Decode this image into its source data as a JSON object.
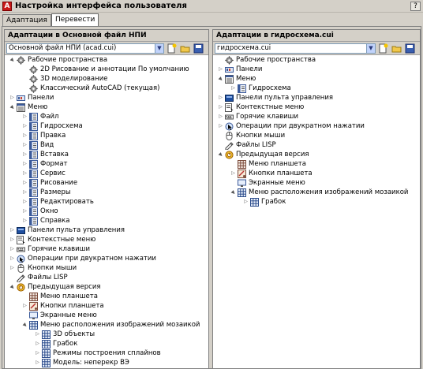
{
  "window": {
    "title": "Настройка интерфейса пользователя",
    "help_label": "?"
  },
  "tabs": [
    {
      "label": "Адаптация",
      "active": false
    },
    {
      "label": "Перевести",
      "active": true
    }
  ],
  "left_pane": {
    "header": "Адаптации в Основной файл НПИ",
    "file_value": "Основной файл НПИ (acad.cui)",
    "tree": [
      {
        "level": 0,
        "toggle": "open",
        "icon": "gear",
        "label": "Рабочие пространства"
      },
      {
        "level": 1,
        "toggle": "none",
        "icon": "gear",
        "label": "2D Рисование и аннотации По умолчанию"
      },
      {
        "level": 1,
        "toggle": "none",
        "icon": "gear",
        "label": "3D моделирование"
      },
      {
        "level": 1,
        "toggle": "none",
        "icon": "gear",
        "label": "Классический AutoCAD (текущая)"
      },
      {
        "level": 0,
        "toggle": "closed",
        "icon": "toolbar",
        "label": "Панели"
      },
      {
        "level": 0,
        "toggle": "open",
        "icon": "menu",
        "label": "Меню"
      },
      {
        "level": 1,
        "toggle": "closed",
        "icon": "menu-item",
        "label": "Файл"
      },
      {
        "level": 1,
        "toggle": "closed",
        "icon": "menu-item",
        "label": "Гидросхема"
      },
      {
        "level": 1,
        "toggle": "closed",
        "icon": "menu-item",
        "label": "Правка"
      },
      {
        "level": 1,
        "toggle": "closed",
        "icon": "menu-item",
        "label": "Вид"
      },
      {
        "level": 1,
        "toggle": "closed",
        "icon": "menu-item",
        "label": "Вставка"
      },
      {
        "level": 1,
        "toggle": "closed",
        "icon": "menu-item",
        "label": "Формат"
      },
      {
        "level": 1,
        "toggle": "closed",
        "icon": "menu-item",
        "label": "Сервис"
      },
      {
        "level": 1,
        "toggle": "closed",
        "icon": "menu-item",
        "label": "Рисование"
      },
      {
        "level": 1,
        "toggle": "closed",
        "icon": "menu-item",
        "label": "Размеры"
      },
      {
        "level": 1,
        "toggle": "closed",
        "icon": "menu-item",
        "label": "Редактировать"
      },
      {
        "level": 1,
        "toggle": "closed",
        "icon": "menu-item",
        "label": "Окно"
      },
      {
        "level": 1,
        "toggle": "closed",
        "icon": "menu-item",
        "label": "Справка"
      },
      {
        "level": 0,
        "toggle": "closed",
        "icon": "dashboard",
        "label": "Панели пульта управления"
      },
      {
        "level": 0,
        "toggle": "closed",
        "icon": "context",
        "label": "Контекстные меню"
      },
      {
        "level": 0,
        "toggle": "closed",
        "icon": "keys",
        "label": "Горячие клавиши"
      },
      {
        "level": 0,
        "toggle": "closed",
        "icon": "dblclick",
        "label": "Операции при двукратном нажатии"
      },
      {
        "level": 0,
        "toggle": "closed",
        "icon": "mouse",
        "label": "Кнопки мыши"
      },
      {
        "level": 0,
        "toggle": "none",
        "icon": "lisp",
        "label": "Файлы LISP"
      },
      {
        "level": 0,
        "toggle": "open",
        "icon": "legacy",
        "label": "Предыдущая версия"
      },
      {
        "level": 1,
        "toggle": "none",
        "icon": "tablet",
        "label": "Меню планшета"
      },
      {
        "level": 1,
        "toggle": "closed",
        "icon": "tablet-btn",
        "label": "Кнопки планшета"
      },
      {
        "level": 1,
        "toggle": "none",
        "icon": "screen",
        "label": "Экранные меню"
      },
      {
        "level": 1,
        "toggle": "open",
        "icon": "grid",
        "label": "Меню расположения изображений мозаикой"
      },
      {
        "level": 2,
        "toggle": "closed",
        "icon": "grid",
        "label": "3D объекты"
      },
      {
        "level": 2,
        "toggle": "closed",
        "icon": "grid",
        "label": "Грабок"
      },
      {
        "level": 2,
        "toggle": "closed",
        "icon": "grid",
        "label": "Режимы построения сплайнов"
      },
      {
        "level": 2,
        "toggle": "closed",
        "icon": "grid",
        "label": "Модель: неперекр ВЭ"
      }
    ]
  },
  "right_pane": {
    "header": "Адаптации в гидросхема.cui",
    "file_value": "гидросхема.cui",
    "tree": [
      {
        "level": 0,
        "toggle": "none",
        "icon": "gear",
        "label": "Рабочие пространства"
      },
      {
        "level": 0,
        "toggle": "closed",
        "icon": "toolbar",
        "label": "Панели"
      },
      {
        "level": 0,
        "toggle": "open",
        "icon": "menu",
        "label": "Меню"
      },
      {
        "level": 1,
        "toggle": "closed",
        "icon": "menu-item",
        "label": "Гидросхема"
      },
      {
        "level": 0,
        "toggle": "closed",
        "icon": "dashboard",
        "label": "Панели пульта управления"
      },
      {
        "level": 0,
        "toggle": "closed",
        "icon": "context",
        "label": "Контекстные меню"
      },
      {
        "level": 0,
        "toggle": "closed",
        "icon": "keys",
        "label": "Горячие клавиши"
      },
      {
        "level": 0,
        "toggle": "closed",
        "icon": "dblclick",
        "label": "Операции при двукратном нажатии"
      },
      {
        "level": 0,
        "toggle": "none",
        "icon": "mouse",
        "label": "Кнопки мыши"
      },
      {
        "level": 0,
        "toggle": "none",
        "icon": "lisp",
        "label": "Файлы LISP"
      },
      {
        "level": 0,
        "toggle": "open",
        "icon": "legacy",
        "label": "Предыдущая версия"
      },
      {
        "level": 1,
        "toggle": "none",
        "icon": "tablet",
        "label": "Меню планшета"
      },
      {
        "level": 1,
        "toggle": "closed",
        "icon": "tablet-btn",
        "label": "Кнопки планшета"
      },
      {
        "level": 1,
        "toggle": "none",
        "icon": "screen",
        "label": "Экранные меню"
      },
      {
        "level": 1,
        "toggle": "open",
        "icon": "grid",
        "label": "Меню расположения изображений мозаикой"
      },
      {
        "level": 2,
        "toggle": "closed",
        "icon": "grid",
        "label": "Грабок"
      }
    ]
  }
}
